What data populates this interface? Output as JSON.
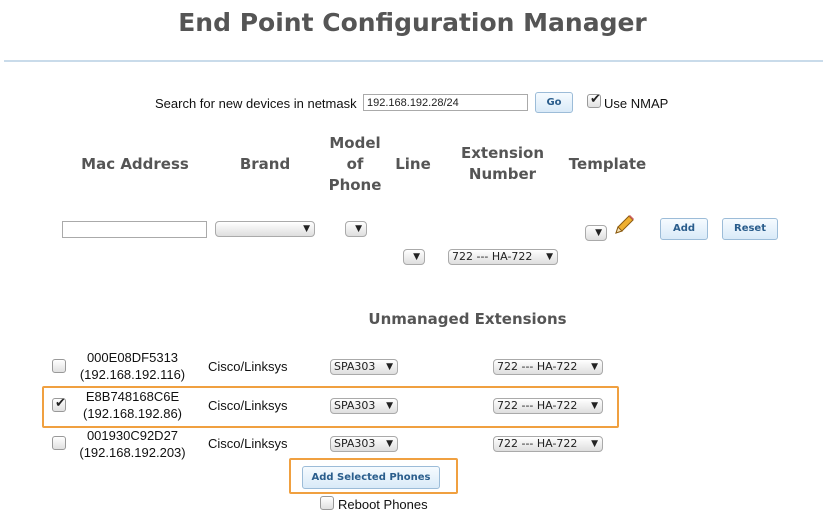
{
  "page": {
    "title": "End Point Configuration Manager"
  },
  "search": {
    "label": "Search for new devices in netmask",
    "netmask": "192.168.192.28/24",
    "go_label": "Go",
    "use_nmap_label": "Use NMAP",
    "use_nmap_checked": true
  },
  "columns": {
    "mac": "Mac Address",
    "brand": "Brand",
    "model_line1": "Model",
    "model_line2": "of",
    "model_line3": "Phone",
    "line": "Line",
    "ext_line1": "Extension",
    "ext_line2": "Number",
    "template": "Template"
  },
  "add_form": {
    "mac_value": "",
    "brand_selected": "",
    "model_selected": "",
    "line_selected": "",
    "extension_selected": "722 --- HA-722",
    "template_selected": "",
    "edit_icon": "pencil-icon",
    "add_label": "Add",
    "reset_label": "Reset"
  },
  "unmanaged": {
    "heading": "Unmanaged Extensions",
    "rows": [
      {
        "mac": "000E08DF5313",
        "ip": "(192.168.192.116)",
        "brand": "Cisco/Linksys",
        "model": "SPA303",
        "extension": "722 --- HA-722",
        "checked": false,
        "highlighted": false
      },
      {
        "mac": "E8B748168C6E",
        "ip": "(192.168.192.86)",
        "brand": "Cisco/Linksys",
        "model": "SPA303",
        "extension": "722 --- HA-722",
        "checked": true,
        "highlighted": true
      },
      {
        "mac": "001930C92D27",
        "ip": "(192.168.192.203)",
        "brand": "Cisco/Linksys",
        "model": "SPA303",
        "extension": "722 --- HA-722",
        "checked": false,
        "highlighted": false
      }
    ],
    "add_selected_label": "Add Selected Phones",
    "reboot_label": "Reboot Phones",
    "reboot_checked": false
  },
  "colors": {
    "highlight": "#f0a040",
    "header_text": "#555555",
    "rule": "#c9dbea",
    "button_text": "#2a5d8c"
  }
}
